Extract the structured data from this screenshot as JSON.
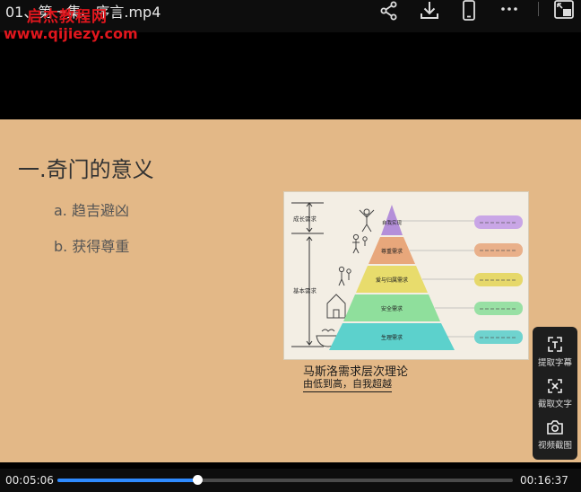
{
  "player": {
    "file_title": "01、第一集、序言.mp4",
    "toolbar_icons": [
      "share-icon",
      "download-icon",
      "phone-icon",
      "more-icon",
      "pip-icon"
    ],
    "current_time": "00:05:06",
    "total_time": "00:16:37",
    "progress": 0.307
  },
  "watermark": {
    "line1": "启杰教程网",
    "line2": "www.qijiezy.com",
    "color": "#e0161d"
  },
  "slide": {
    "heading": "一.奇门的意义",
    "bullets": [
      "a.  趋吉避凶",
      "b.  获得尊重"
    ],
    "background": "#e3b887",
    "diagram": {
      "left_labels": [
        "成长需求",
        "基本需求"
      ],
      "levels": [
        {
          "label": "自我实现",
          "color": "#b48fd9"
        },
        {
          "label": "尊重需求",
          "color": "#e8a77b"
        },
        {
          "label": "爱与归属需求",
          "color": "#e8dc6c"
        },
        {
          "label": "安全需求",
          "color": "#8fdf9c"
        },
        {
          "label": "生理需求",
          "color": "#5cd1cc"
        }
      ]
    },
    "caption": "马斯洛需求层次理论",
    "caption_sub": "由低到高，自我超越"
  },
  "side_panel": {
    "items": [
      {
        "label": "提取字幕",
        "icon": "subtitle-extract-icon"
      },
      {
        "label": "截取文字",
        "icon": "text-capture-icon"
      },
      {
        "label": "视频截图",
        "icon": "camera-icon"
      }
    ]
  }
}
